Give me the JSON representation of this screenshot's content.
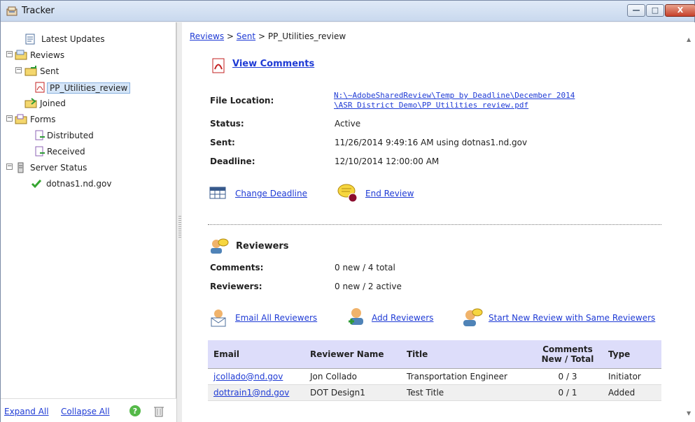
{
  "window": {
    "title": "Tracker",
    "buttons": [
      "—",
      "□",
      "X"
    ]
  },
  "tree": {
    "items": [
      {
        "label": "Latest Updates",
        "icon": "updates-icon",
        "level": 0
      },
      {
        "label": "Reviews",
        "icon": "reviews-folder-icon",
        "level": 0,
        "expanded": true
      },
      {
        "label": "Sent",
        "icon": "sent-folder-icon",
        "level": 1,
        "expanded": true
      },
      {
        "label": "PP_Utilities_review",
        "icon": "pdf-icon",
        "level": 2,
        "selected": true
      },
      {
        "label": "Joined",
        "icon": "joined-folder-icon",
        "level": 1
      },
      {
        "label": "Forms",
        "icon": "forms-folder-icon",
        "level": 0,
        "expanded": true
      },
      {
        "label": "Distributed",
        "icon": "distributed-icon",
        "level": 1
      },
      {
        "label": "Received",
        "icon": "received-icon",
        "level": 1
      },
      {
        "label": "Server Status",
        "icon": "server-icon",
        "level": 0,
        "expanded": true
      },
      {
        "label": "dotnas1.nd.gov",
        "icon": "check-icon",
        "level": 1
      }
    ],
    "footer": {
      "expand_all": "Expand All",
      "collapse_all": "Collapse All"
    }
  },
  "breadcrumb": {
    "first": "Reviews",
    "sep1": ">",
    "second": "Sent",
    "sep2": ">",
    "current": "PP_Utilities_review"
  },
  "details": {
    "view_comments": "View Comments",
    "file_location_label": "File Location:",
    "file_location_line1": "N:\\~AdobeSharedReview\\Temp by Deadline\\December 2014",
    "file_location_line2": "\\ASR District Demo\\PP Utilities review.pdf",
    "status_label": "Status:",
    "status_value": "Active",
    "sent_label": "Sent:",
    "sent_value": "11/26/2014 9:49:16 AM using dotnas1.nd.gov",
    "deadline_label": "Deadline:",
    "deadline_value": "12/10/2014 12:00:00 AM",
    "change_deadline": "Change Deadline",
    "end_review": "End Review"
  },
  "reviewers": {
    "heading": "Reviewers",
    "comments_label": "Comments:",
    "comments_value": "0 new / 4 total",
    "reviewers_label": "Reviewers:",
    "reviewers_value": "0 new / 2 active",
    "email_all": "Email All Reviewers",
    "add": "Add Reviewers",
    "start_new": "Start New Review with Same Reviewers",
    "columns": {
      "email": "Email",
      "name": "Reviewer Name",
      "title": "Title",
      "comments_line1": "Comments",
      "comments_line2": "New / Total",
      "type": "Type"
    },
    "rows": [
      {
        "email": "jcollado@nd.gov",
        "name": "Jon Collado",
        "title": "Transportation Engineer",
        "comments": "0 / 3",
        "type": "Initiator"
      },
      {
        "email": "dottrain1@nd.gov",
        "name": "DOT Design1",
        "title": "Test Title",
        "comments": "0 / 1",
        "type": "Added"
      }
    ]
  }
}
